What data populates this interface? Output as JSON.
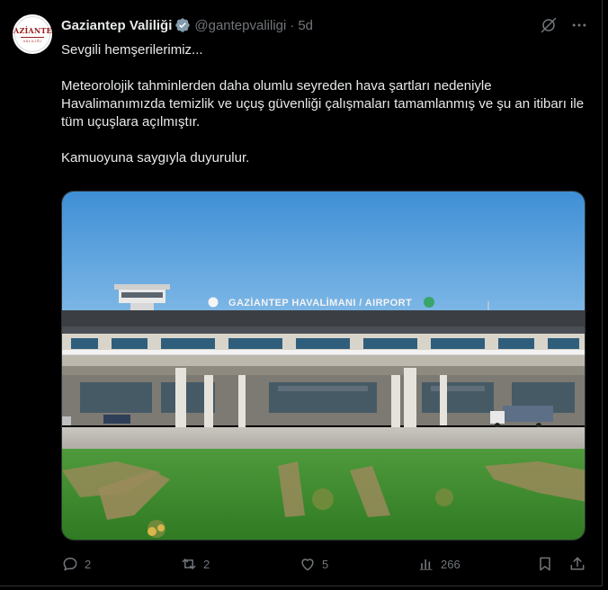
{
  "tweet": {
    "display_name": "Gaziantep Valiliği",
    "handle": "@gantepvaliligi",
    "separator": "·",
    "time": "5d",
    "paragraphs": [
      "Sevgili hemşerilerimiz...",
      "Meteorolojik tahminlerden daha olumlu seyreden hava şartları nedeniyle Havalimanımızda temizlik ve uçuş güvenliği çalışmaları tamamlanmış ve şu an itibarı ile tüm uçuşlara açılmıştır.",
      "Kamuoyuna saygıyla duyurulur."
    ],
    "avatar_logo_text": "GAZİANTEP",
    "avatar_logo_sub": "VALİLİĞİ",
    "image_sign": "GAZİANTEP HAVALİMANI / AIRPORT"
  },
  "actions": {
    "reply_count": "2",
    "repost_count": "2",
    "like_count": "5",
    "views_count": "266"
  },
  "icons": {
    "verified": "verified-badge-icon",
    "grok": "grok-icon",
    "more": "more-icon",
    "reply": "reply-icon",
    "repost": "repost-icon",
    "like": "heart-icon",
    "views": "analytics-icon",
    "bookmark": "bookmark-icon",
    "share": "share-icon"
  },
  "colors": {
    "background": "#000000",
    "text": "#e7e9ea",
    "muted": "#71767b",
    "verified": "#829aab"
  }
}
